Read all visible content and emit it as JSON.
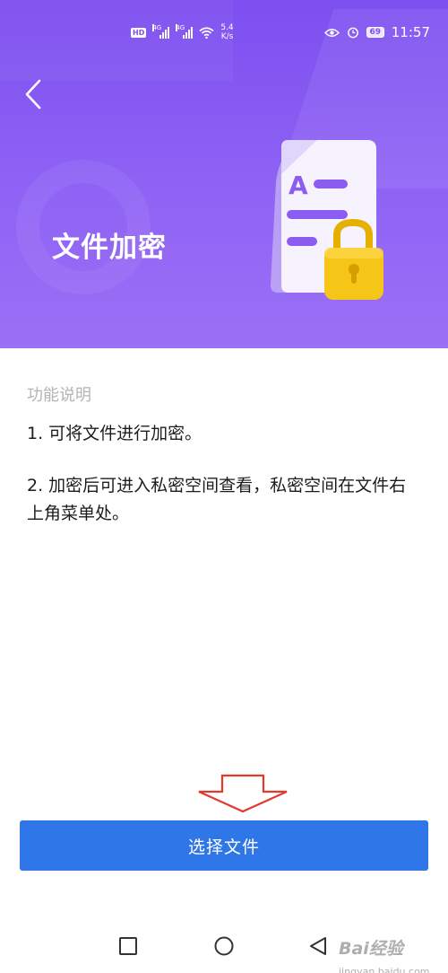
{
  "status_bar": {
    "hd_label": "HD",
    "network_1": "4G",
    "network_2": "4G",
    "speed_value": "5.4",
    "speed_unit": "K/s",
    "battery": "69",
    "time": "11:57",
    "icons": [
      "hd-icon",
      "signal-icon",
      "signal-icon",
      "wifi-icon",
      "eye-icon",
      "alarm-icon",
      "battery-icon"
    ]
  },
  "header": {
    "title": "文件加密",
    "illustration_letter": "A",
    "icons": [
      "back-arrow-icon",
      "document-lock-illustration"
    ]
  },
  "content": {
    "section_title": "功能说明",
    "item_1": "1. 可将文件进行加密。",
    "item_2": "2. 加密后可进入私密空间查看，私密空间在文件右上角菜单处。"
  },
  "annotation": {
    "icon": "down-arrow-icon",
    "color": "#e23a2f"
  },
  "action": {
    "select_file_label": "选择文件",
    "color": "#2f77e8"
  },
  "nav_bar": {
    "icons": [
      "square-recent-icon",
      "circle-home-icon",
      "triangle-back-icon"
    ]
  },
  "watermark": {
    "text": "Bai",
    "suffix": "经验",
    "sub": "jingyan.baidu.com"
  },
  "colors": {
    "header_bg": "#7d4ff0",
    "lock_gold": "#f5c518"
  }
}
